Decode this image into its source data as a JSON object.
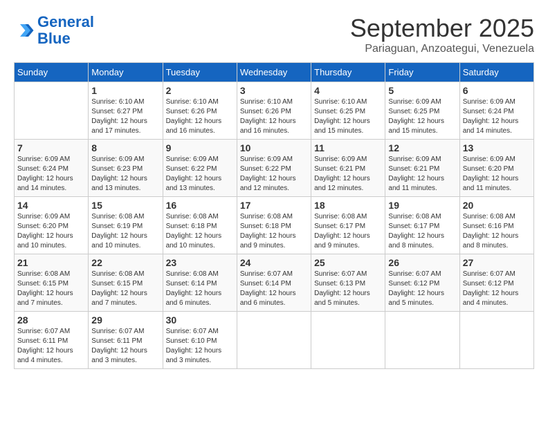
{
  "header": {
    "logo_line1": "General",
    "logo_line2": "Blue",
    "month": "September 2025",
    "location": "Pariaguan, Anzoategui, Venezuela"
  },
  "days_of_week": [
    "Sunday",
    "Monday",
    "Tuesday",
    "Wednesday",
    "Thursday",
    "Friday",
    "Saturday"
  ],
  "weeks": [
    [
      {
        "day": "",
        "detail": ""
      },
      {
        "day": "1",
        "detail": "Sunrise: 6:10 AM\nSunset: 6:27 PM\nDaylight: 12 hours\nand 17 minutes."
      },
      {
        "day": "2",
        "detail": "Sunrise: 6:10 AM\nSunset: 6:26 PM\nDaylight: 12 hours\nand 16 minutes."
      },
      {
        "day": "3",
        "detail": "Sunrise: 6:10 AM\nSunset: 6:26 PM\nDaylight: 12 hours\nand 16 minutes."
      },
      {
        "day": "4",
        "detail": "Sunrise: 6:10 AM\nSunset: 6:25 PM\nDaylight: 12 hours\nand 15 minutes."
      },
      {
        "day": "5",
        "detail": "Sunrise: 6:09 AM\nSunset: 6:25 PM\nDaylight: 12 hours\nand 15 minutes."
      },
      {
        "day": "6",
        "detail": "Sunrise: 6:09 AM\nSunset: 6:24 PM\nDaylight: 12 hours\nand 14 minutes."
      }
    ],
    [
      {
        "day": "7",
        "detail": "Sunrise: 6:09 AM\nSunset: 6:24 PM\nDaylight: 12 hours\nand 14 minutes."
      },
      {
        "day": "8",
        "detail": "Sunrise: 6:09 AM\nSunset: 6:23 PM\nDaylight: 12 hours\nand 13 minutes."
      },
      {
        "day": "9",
        "detail": "Sunrise: 6:09 AM\nSunset: 6:22 PM\nDaylight: 12 hours\nand 13 minutes."
      },
      {
        "day": "10",
        "detail": "Sunrise: 6:09 AM\nSunset: 6:22 PM\nDaylight: 12 hours\nand 12 minutes."
      },
      {
        "day": "11",
        "detail": "Sunrise: 6:09 AM\nSunset: 6:21 PM\nDaylight: 12 hours\nand 12 minutes."
      },
      {
        "day": "12",
        "detail": "Sunrise: 6:09 AM\nSunset: 6:21 PM\nDaylight: 12 hours\nand 11 minutes."
      },
      {
        "day": "13",
        "detail": "Sunrise: 6:09 AM\nSunset: 6:20 PM\nDaylight: 12 hours\nand 11 minutes."
      }
    ],
    [
      {
        "day": "14",
        "detail": "Sunrise: 6:09 AM\nSunset: 6:20 PM\nDaylight: 12 hours\nand 10 minutes."
      },
      {
        "day": "15",
        "detail": "Sunrise: 6:08 AM\nSunset: 6:19 PM\nDaylight: 12 hours\nand 10 minutes."
      },
      {
        "day": "16",
        "detail": "Sunrise: 6:08 AM\nSunset: 6:18 PM\nDaylight: 12 hours\nand 10 minutes."
      },
      {
        "day": "17",
        "detail": "Sunrise: 6:08 AM\nSunset: 6:18 PM\nDaylight: 12 hours\nand 9 minutes."
      },
      {
        "day": "18",
        "detail": "Sunrise: 6:08 AM\nSunset: 6:17 PM\nDaylight: 12 hours\nand 9 minutes."
      },
      {
        "day": "19",
        "detail": "Sunrise: 6:08 AM\nSunset: 6:17 PM\nDaylight: 12 hours\nand 8 minutes."
      },
      {
        "day": "20",
        "detail": "Sunrise: 6:08 AM\nSunset: 6:16 PM\nDaylight: 12 hours\nand 8 minutes."
      }
    ],
    [
      {
        "day": "21",
        "detail": "Sunrise: 6:08 AM\nSunset: 6:15 PM\nDaylight: 12 hours\nand 7 minutes."
      },
      {
        "day": "22",
        "detail": "Sunrise: 6:08 AM\nSunset: 6:15 PM\nDaylight: 12 hours\nand 7 minutes."
      },
      {
        "day": "23",
        "detail": "Sunrise: 6:08 AM\nSunset: 6:14 PM\nDaylight: 12 hours\nand 6 minutes."
      },
      {
        "day": "24",
        "detail": "Sunrise: 6:07 AM\nSunset: 6:14 PM\nDaylight: 12 hours\nand 6 minutes."
      },
      {
        "day": "25",
        "detail": "Sunrise: 6:07 AM\nSunset: 6:13 PM\nDaylight: 12 hours\nand 5 minutes."
      },
      {
        "day": "26",
        "detail": "Sunrise: 6:07 AM\nSunset: 6:12 PM\nDaylight: 12 hours\nand 5 minutes."
      },
      {
        "day": "27",
        "detail": "Sunrise: 6:07 AM\nSunset: 6:12 PM\nDaylight: 12 hours\nand 4 minutes."
      }
    ],
    [
      {
        "day": "28",
        "detail": "Sunrise: 6:07 AM\nSunset: 6:11 PM\nDaylight: 12 hours\nand 4 minutes."
      },
      {
        "day": "29",
        "detail": "Sunrise: 6:07 AM\nSunset: 6:11 PM\nDaylight: 12 hours\nand 3 minutes."
      },
      {
        "day": "30",
        "detail": "Sunrise: 6:07 AM\nSunset: 6:10 PM\nDaylight: 12 hours\nand 3 minutes."
      },
      {
        "day": "",
        "detail": ""
      },
      {
        "day": "",
        "detail": ""
      },
      {
        "day": "",
        "detail": ""
      },
      {
        "day": "",
        "detail": ""
      }
    ]
  ]
}
